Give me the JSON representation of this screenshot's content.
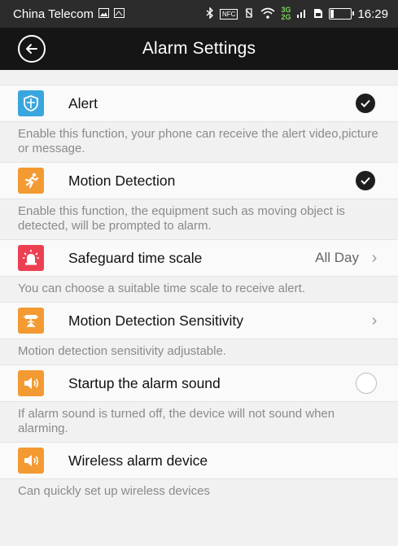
{
  "status_bar": {
    "carrier": "China Telecom",
    "time": "16:29",
    "nfc_badge": "NFC",
    "network_badge": "3G\n2G",
    "battery_level": 0.15
  },
  "header": {
    "title": "Alarm Settings",
    "back_icon": "back-arrow-circle-icon"
  },
  "settings": [
    {
      "key": "alert",
      "label": "Alert",
      "icon": "shield-icon",
      "icon_color": "#3aa6df",
      "control": "checked",
      "description": "Enable this function, your phone can receive the alert video,picture or message."
    },
    {
      "key": "motion",
      "label": "Motion Detection",
      "icon": "running-man-icon",
      "icon_color": "#f39a33",
      "control": "checked",
      "description": "Enable this function, the equipment such as moving object is detected, will be prompted to alarm."
    },
    {
      "key": "safeguard",
      "label": "Safeguard time scale",
      "icon": "alarm-siren-icon",
      "icon_color": "#ec4052",
      "control": "chevron",
      "value": "All Day",
      "description": "You can choose a suitable time scale to receive alert."
    },
    {
      "key": "sensitivity",
      "label": "Motion Detection Sensitivity",
      "icon": "camera-sensor-icon",
      "icon_color": "#f39a33",
      "control": "chevron",
      "description": "Motion detection sensitivity adjustable."
    },
    {
      "key": "sound",
      "label": "Startup the alarm sound",
      "icon": "speaker-icon",
      "icon_color": "#f39a33",
      "control": "unchecked",
      "description": "If alarm sound is turned off, the device will not sound when alarming."
    },
    {
      "key": "wireless",
      "label": "Wireless alarm device",
      "icon": "speaker-icon",
      "icon_color": "#f39a33",
      "control": "none",
      "description": "Can quickly set up wireless devices"
    }
  ],
  "chevron_glyph": "›"
}
